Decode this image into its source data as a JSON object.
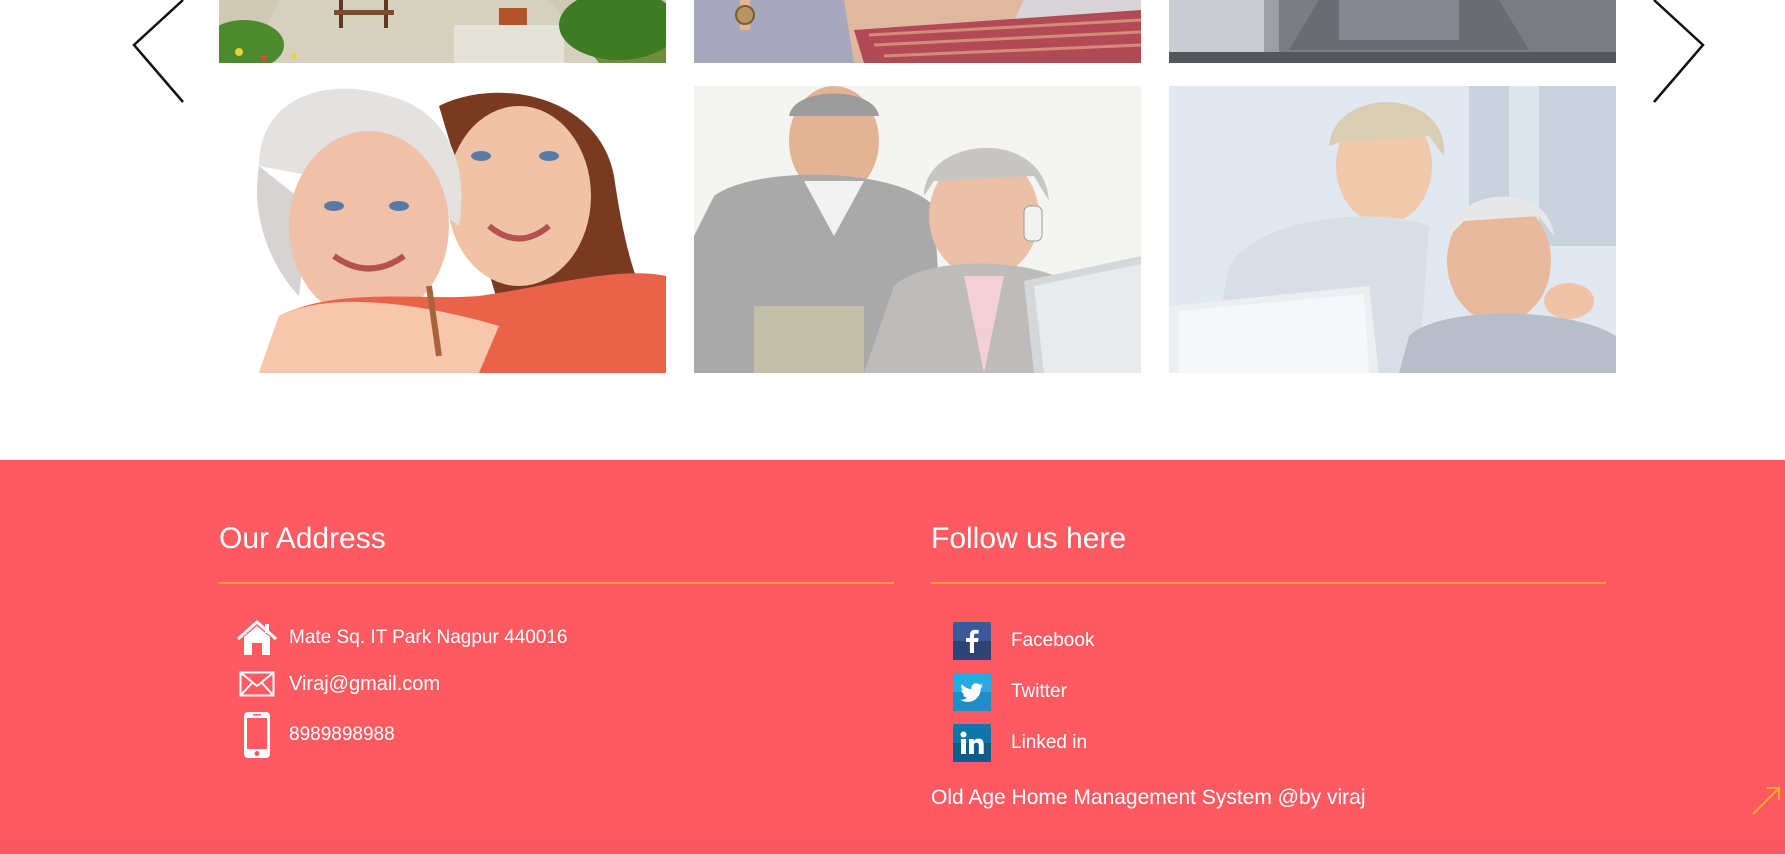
{
  "gallery": {
    "prev_arrow": "chevron-left-icon",
    "next_arrow": "chevron-right-icon",
    "photos": [
      {
        "name": "photo-garden-patio"
      },
      {
        "name": "photo-couple-embrace"
      },
      {
        "name": "photo-man-laptop"
      },
      {
        "name": "photo-elderly-woman-and-daughter"
      },
      {
        "name": "photo-elderly-couple-phone-laptop"
      },
      {
        "name": "photo-elderly-couple-laptop"
      }
    ]
  },
  "footer": {
    "background": "#fd5a62",
    "rule_color": "#f7a52a",
    "address": {
      "title": "Our Address",
      "street": "Mate Sq. IT Park Nagpur 440016",
      "email": "Viraj@gmail.com",
      "phone": "8989898988"
    },
    "follow": {
      "title": "Follow us here",
      "links": [
        {
          "label": "Facebook",
          "icon": "facebook-icon",
          "color": "#3b5998"
        },
        {
          "label": "Twitter",
          "icon": "twitter-icon",
          "color": "#1da1f2"
        },
        {
          "label": "Linked in",
          "icon": "linkedin-icon",
          "color": "#0e76a8"
        }
      ]
    },
    "copyright": "Old Age Home Management System @by viraj"
  }
}
